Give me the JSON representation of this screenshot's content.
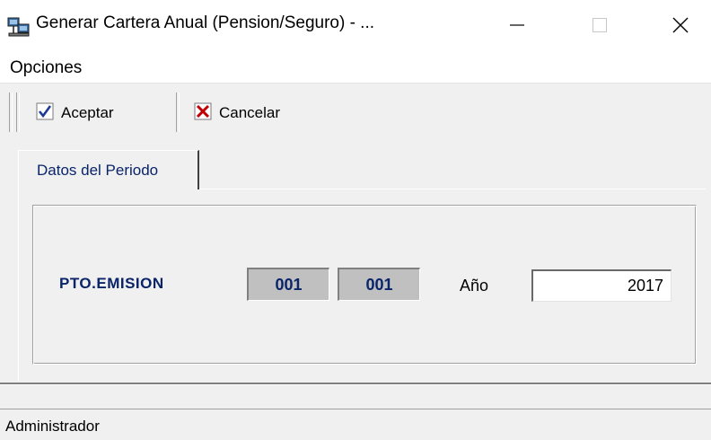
{
  "window": {
    "title": "Generar Cartera Anual (Pension/Seguro) - ...",
    "icon": "network-computers-icon",
    "controls": {
      "minimize": "minimize-icon",
      "maximize": "maximize-icon",
      "close": "close-icon"
    }
  },
  "menu": {
    "items": [
      {
        "label": "Opciones"
      }
    ]
  },
  "toolbar": {
    "accept_label": "Aceptar",
    "cancel_label": "Cancelar",
    "accept_icon": "checkmark-icon",
    "cancel_icon": "x-icon"
  },
  "tabs": [
    {
      "label": "Datos del Periodo",
      "active": true
    }
  ],
  "form": {
    "pto_label": "PTO.EMISION",
    "pto_values": [
      "001",
      "001"
    ],
    "year_label": "Año",
    "year_value": "2017"
  },
  "status": {
    "text": "Administrador"
  },
  "colors": {
    "label_blue": "#0a246a",
    "cancel_red": "#c00000",
    "check_blue": "#1e3c96"
  }
}
